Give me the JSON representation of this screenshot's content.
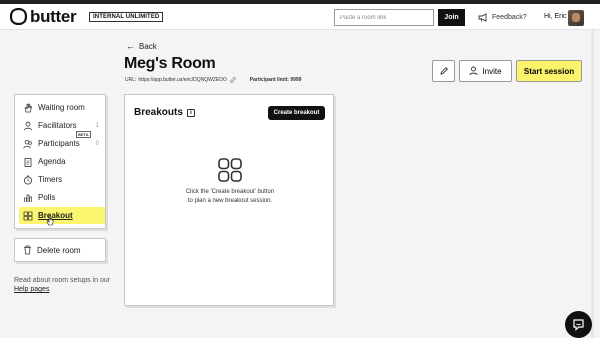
{
  "navbar": {
    "logo_text": "butter",
    "plan_badge": "INTERNAL UNLIMITED",
    "room_link_placeholder": "Paste a room link",
    "join_label": "Join",
    "feedback_label": "Feedback?",
    "greeting": "Hi, Eric"
  },
  "header": {
    "back_label": "Back",
    "room_title": "Meg's Room",
    "url_label": "URL:",
    "url_value": "https://app.butter.us/eric/DQNQWZEDO",
    "participant_limit": "Participant limit: 9999",
    "invite_label": "Invite",
    "start_label": "Start session"
  },
  "sidebar": {
    "items": [
      {
        "label": "Waiting room",
        "icon": "hand-icon",
        "count": ""
      },
      {
        "label": "Facilitators",
        "icon": "user-icon",
        "count": "1"
      },
      {
        "label": "Participants",
        "icon": "users-icon",
        "count": "0"
      },
      {
        "label": "Agenda",
        "icon": "clipboard-icon",
        "count": ""
      },
      {
        "label": "Timers",
        "icon": "clock-icon",
        "count": ""
      },
      {
        "label": "Polls",
        "icon": "bar-chart-icon",
        "count": ""
      },
      {
        "label": "Breakout",
        "icon": "grid-icon",
        "count": "",
        "active": true
      }
    ],
    "beta_badge": "BETA",
    "delete_label": "Delete room",
    "help_text": "Read about room setups in our",
    "help_link": "Help pages"
  },
  "panel": {
    "title": "Breakouts",
    "info_glyph": "i",
    "create_label": "Create breakout",
    "empty_line1": "Click the 'Create breakout' button",
    "empty_line2": "to plan a new breakout session."
  },
  "colors": {
    "accent_yellow": "#fbf36b",
    "dark": "#111111"
  }
}
